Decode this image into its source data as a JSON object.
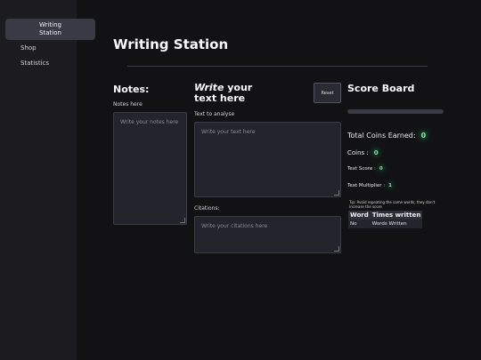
{
  "sidebar": {
    "items": [
      {
        "label": "Writing Station"
      },
      {
        "label": "Shop"
      },
      {
        "label": "Statistics"
      }
    ]
  },
  "page": {
    "title": "Writing Station"
  },
  "notes": {
    "title": "Notes:",
    "label": "Notes here",
    "placeholder": "Write your notes here"
  },
  "writer": {
    "title_emph": "Write",
    "title_rest": " your text here",
    "reset_label": "Reset",
    "text_label": "Text to analyse",
    "text_placeholder": "Write your text here",
    "citations_label": "Citations:",
    "citations_placeholder": "Write your citations here"
  },
  "scoreboard": {
    "title": "Score Board",
    "progress": 0,
    "total_coins_label": "Total Coins Earned:",
    "total_coins": "0",
    "coins_label": "Coins :",
    "coins": "0",
    "text_score_label": "Text Score :",
    "text_score": "0",
    "multiplier_label": "Text Multiplier :",
    "multiplier": "1",
    "tip": "Tip: Avoid repeating the same words, they don't increase the score",
    "table": {
      "headers": [
        "Word",
        "Times written"
      ],
      "rows": [
        [
          "No",
          "Words Written"
        ]
      ]
    }
  },
  "colors": {
    "accent_glow": "#2fbf6a",
    "background": "#121214",
    "sidebar": "#1b1b20"
  }
}
